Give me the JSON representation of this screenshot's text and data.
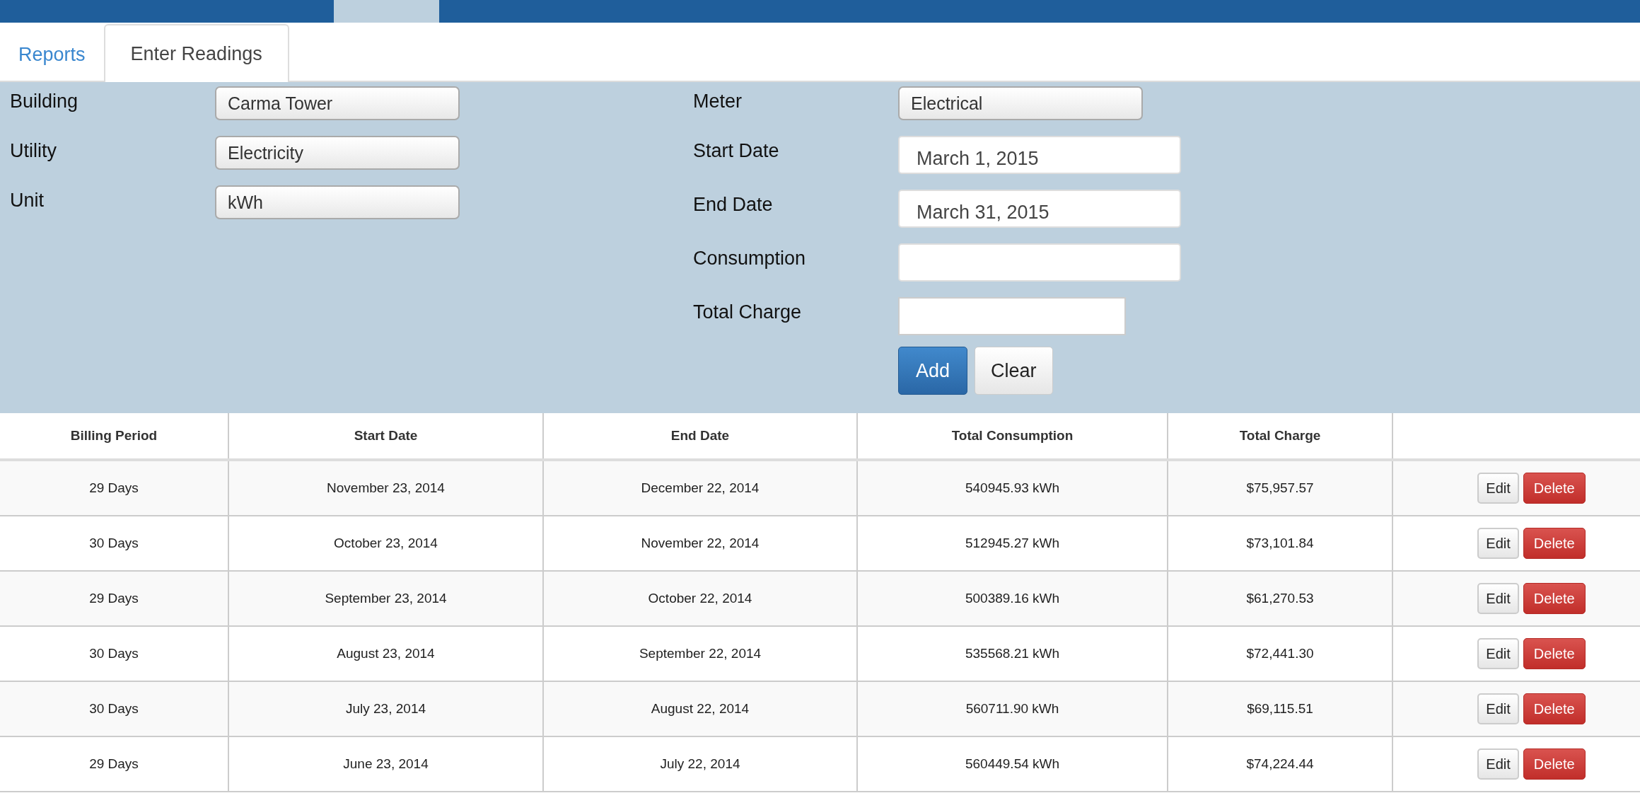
{
  "tabs": [
    {
      "label": "Reports",
      "selected": false
    },
    {
      "label": "Enter Readings",
      "selected": true
    }
  ],
  "form": {
    "left": [
      {
        "label": "Building",
        "kind": "select",
        "value": "Carma Tower"
      },
      {
        "label": "Utility",
        "kind": "select",
        "value": "Electricity"
      },
      {
        "label": "Unit",
        "kind": "select",
        "value": "kWh"
      }
    ],
    "right": [
      {
        "label": "Meter",
        "kind": "select",
        "value": "Electrical"
      },
      {
        "label": "Start Date",
        "kind": "date",
        "value": "March 1, 2015"
      },
      {
        "label": "End Date",
        "kind": "date",
        "value": "March 31, 2015"
      },
      {
        "label": "Consumption",
        "kind": "text"
      },
      {
        "label": "Total Charge",
        "kind": "short"
      }
    ],
    "buttons": [
      {
        "label": "Add",
        "kind": "primary"
      },
      {
        "label": "Clear",
        "kind": "default"
      }
    ]
  },
  "table": {
    "columns": [
      "Billing Period",
      "Start Date",
      "End Date",
      "Total Consumption",
      "Total Charge"
    ],
    "rows": [
      {
        "cells": [
          "29 Days",
          "November 23, 2014",
          "December 22, 2014",
          "540945.93 kWh",
          "$75,957.57"
        ],
        "actions": [
          "Edit",
          "Delete"
        ]
      },
      {
        "cells": [
          "30 Days",
          "October 23, 2014",
          "November 22, 2014",
          "512945.27 kWh",
          "$73,101.84"
        ],
        "actions": [
          "Edit",
          "Delete"
        ]
      },
      {
        "cells": [
          "29 Days",
          "September 23, 2014",
          "October 22, 2014",
          "500389.16 kWh",
          "$61,270.53"
        ],
        "actions": [
          "Edit",
          "Delete"
        ]
      },
      {
        "cells": [
          "30 Days",
          "August 23, 2014",
          "September 22, 2014",
          "535568.21 kWh",
          "$72,441.30"
        ],
        "actions": [
          "Edit",
          "Delete"
        ]
      },
      {
        "cells": [
          "30 Days",
          "July 23, 2014",
          "August 22, 2014",
          "560711.90 kWh",
          "$69,115.51"
        ],
        "actions": [
          "Edit",
          "Delete"
        ]
      },
      {
        "cells": [
          "29 Days",
          "June 23, 2014",
          "July 22, 2014",
          "560449.54 kWh",
          "$74,224.44"
        ],
        "actions": [
          "Edit",
          "Delete"
        ]
      }
    ]
  }
}
